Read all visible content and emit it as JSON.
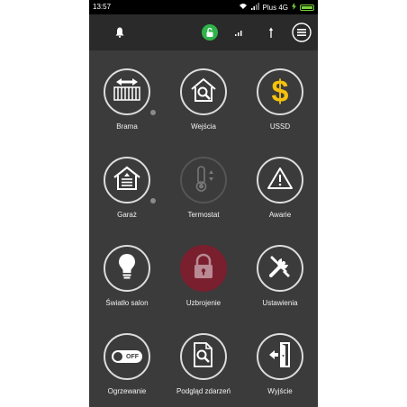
{
  "status_bar": {
    "time": "13:57",
    "carrier": "Plus 4G"
  },
  "tiles": [
    {
      "label": "Brama"
    },
    {
      "label": "Wejścia"
    },
    {
      "label": "USSD"
    },
    {
      "label": "Garaż"
    },
    {
      "label": "Termostat"
    },
    {
      "label": "Awarie"
    },
    {
      "label": "Światło salon"
    },
    {
      "label": "Uzbrojenie"
    },
    {
      "label": "Ustawienia"
    },
    {
      "label": "Ogrzewanie",
      "toggle_text": "OFF"
    },
    {
      "label": "Podgląd zdarzeń"
    },
    {
      "label": "Wyjście"
    }
  ],
  "colors": {
    "accent_green": "#2fb34a",
    "armed_red": "#7a1f2e",
    "usd_yellow": "#f4c20d"
  }
}
